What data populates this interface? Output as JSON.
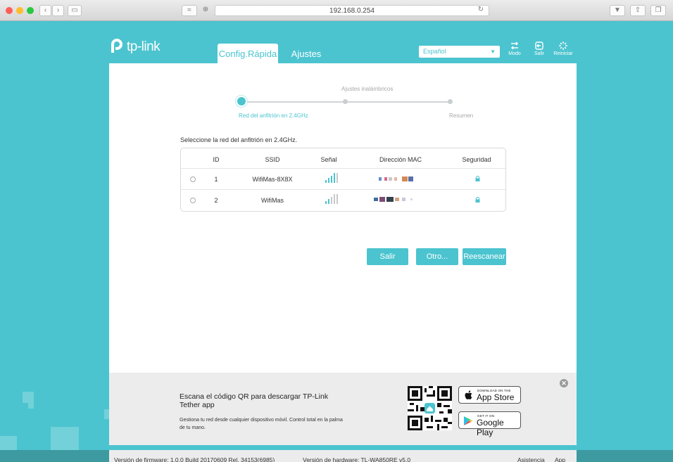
{
  "browser": {
    "url": "192.168.0.254",
    "traffic_lights": [
      "#fe5f57",
      "#febc2e",
      "#28c840"
    ]
  },
  "header": {
    "logo_text": "tp-link",
    "tabs": [
      {
        "label": "Config.Rápida",
        "active": true
      },
      {
        "label": "Ajustes",
        "active": false
      }
    ],
    "language": "Español",
    "icons": [
      {
        "name": "mode-icon",
        "label": "Modo"
      },
      {
        "name": "logout-icon",
        "label": "Salir"
      },
      {
        "name": "reboot-icon",
        "label": "Reiniciar"
      }
    ]
  },
  "wizard": {
    "steps": [
      {
        "label": "Red del anfitrión en 2.4GHz",
        "state": "active"
      },
      {
        "label": "Ajustes inalámbricos",
        "state": "pending"
      },
      {
        "label": "Resumen",
        "state": "pending"
      }
    ]
  },
  "network_list": {
    "instruction": "Seleccione la red del anfitrión en 2.4GHz.",
    "columns": [
      "ID",
      "SSID",
      "Señal",
      "Dirección MAC",
      "Seguridad"
    ],
    "rows": [
      {
        "id": "1",
        "ssid": "WifiMas-8X8X",
        "signal_bars": 4,
        "mac": "redacted",
        "secured": true
      },
      {
        "id": "2",
        "ssid": "WifiMas",
        "signal_bars": 2,
        "mac": "redacted",
        "secured": true
      }
    ]
  },
  "actions": {
    "exit_label": "Salir",
    "other_label": "Otro...",
    "rescan_label": "Reescanear"
  },
  "promo": {
    "title": "Escana el código QR para descargar TP-Link Tether app",
    "description": "Gestiona tu red desde cualquier dispositivo móvil. Control total en la palma de tu mano.",
    "app_store_small": "DOWNLOAD ON THE",
    "app_store_big": "App Store",
    "google_play_small": "GET IT ON",
    "google_play_big": "Google Play"
  },
  "footer": {
    "firmware": "Versión de firmware: 1.0.0 Build 20170609 Rel. 34153(6985)",
    "hardware": "Versión de hardware: TL-WA850RE v5.0",
    "support_label": "Asistencia",
    "app_label": "App"
  },
  "colors": {
    "accent": "#4bc4cf",
    "panel": "#ffffff",
    "promo_bg": "#ececec"
  }
}
